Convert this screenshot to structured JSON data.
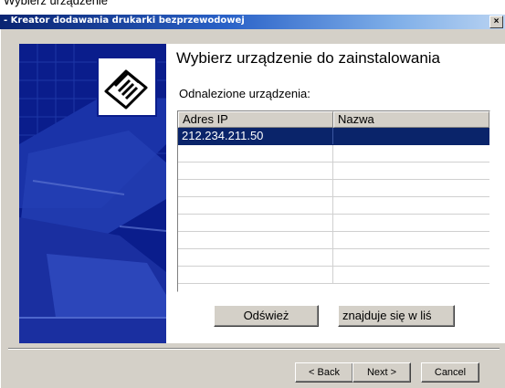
{
  "top_strip": {
    "text": "Wybierz urządzenie"
  },
  "window": {
    "title": "- Kreator dodawania drukarki bezprzewodowej",
    "close_glyph": "×"
  },
  "main": {
    "heading": "Wybierz urządzenie do zainstalowania",
    "found_label": "Odnalezione urządzenia:",
    "device_list": {
      "columns": [
        "Adres IP",
        "Nazwa"
      ],
      "rows": [
        {
          "ip": "212.234.211.50",
          "name": "",
          "selected": true
        },
        {
          "ip": "",
          "name": ""
        },
        {
          "ip": "",
          "name": ""
        },
        {
          "ip": "",
          "name": ""
        },
        {
          "ip": "",
          "name": ""
        },
        {
          "ip": "",
          "name": ""
        },
        {
          "ip": "",
          "name": ""
        },
        {
          "ip": "",
          "name": ""
        },
        {
          "ip": "",
          "name": ""
        }
      ]
    },
    "refresh_label": "Odśwież",
    "name_button_label": "znajduje się w liś"
  },
  "footer": {
    "back_label": "< Back",
    "next_label": "Next >",
    "cancel_label": "Cancel"
  },
  "colors": {
    "panel_blue": "#0a1d8c",
    "selection": "#0a246a",
    "face": "#d4d0c8"
  }
}
